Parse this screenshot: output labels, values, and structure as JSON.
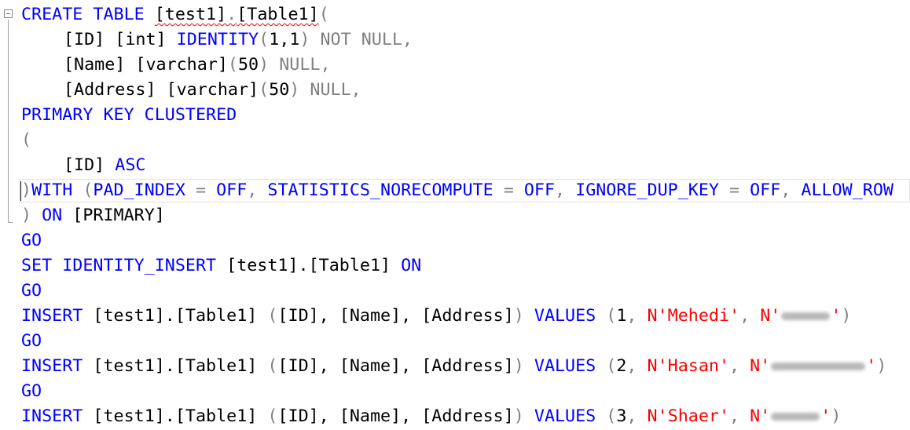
{
  "editor": {
    "l1": {
      "kw": "CREATE TABLE ",
      "obj": "[test1]",
      "dot": ".",
      "tbl": "[Table1]",
      "paren": "("
    },
    "l2": {
      "id": "[ID]",
      "sp": " ",
      "type": "[int]",
      "kw": "IDENTITY",
      "open": "(",
      "args": "1,1",
      "close": ")",
      "rest": " NOT NULL,"
    },
    "l3": {
      "name": "[Name] [varchar]",
      "open": "(",
      "n": "50",
      "rest": ") NULL,"
    },
    "l4": {
      "name": "[Address] [varchar]",
      "open": "(",
      "n": "50",
      "rest": ") NULL,"
    },
    "l5": {
      "kw": "PRIMARY KEY CLUSTERED"
    },
    "l6": {
      "paren": "("
    },
    "l7": {
      "id": "[ID]",
      "kw": " ASC"
    },
    "l8": {
      "paren": ")",
      "kw1": "WITH",
      "open": " (",
      "o1": "PAD_INDEX",
      "eq1": " = ",
      "v1": "OFF",
      "c1": ", ",
      "o2": "STATISTICS_NORECOMPUTE",
      "eq2": " = ",
      "v2": "OFF",
      "c2": ", ",
      "o3": "IGNORE_DUP_KEY",
      "eq3": " = ",
      "v3": "OFF",
      "c3": ", ",
      "o4": "ALLOW_ROW"
    },
    "l9": {
      "paren": ")",
      "kw": " ON ",
      "fg": "[PRIMARY]"
    },
    "go": "GO",
    "l11": {
      "kw1": "SET IDENTITY_INSERT ",
      "obj": "[test1].[Table1]",
      "kw2": " ON"
    },
    "inserts": [
      {
        "kw": "INSERT ",
        "obj": "[test1].[Table1]",
        "cols_open": " (",
        "cols": "[ID], [Name], [Address]",
        "cols_close": ")",
        "values_kw": " VALUES ",
        "vopen": "(",
        "num": "1",
        "comma": ", ",
        "name": "N'Mehedi'",
        "comma2": ", ",
        "addr_prefix": "N'",
        "addr_suffix": "'",
        "vclose": ")"
      },
      {
        "kw": "INSERT ",
        "obj": "[test1].[Table1]",
        "cols_open": " (",
        "cols": "[ID], [Name], [Address]",
        "cols_close": ")",
        "values_kw": " VALUES ",
        "vopen": "(",
        "num": "2",
        "comma": ", ",
        "name": "N'Hasan'",
        "comma2": ", ",
        "addr_prefix": "N'",
        "addr_suffix": "'",
        "vclose": ")"
      },
      {
        "kw": "INSERT ",
        "obj": "[test1].[Table1]",
        "cols_open": " (",
        "cols": "[ID], [Name], [Address]",
        "cols_close": ")",
        "values_kw": " VALUES ",
        "vopen": "(",
        "num": "3",
        "comma": ", ",
        "name": "N'Shaer'",
        "comma2": ", ",
        "addr_prefix": "N'",
        "addr_suffix": "'",
        "vclose": ")"
      }
    ]
  }
}
